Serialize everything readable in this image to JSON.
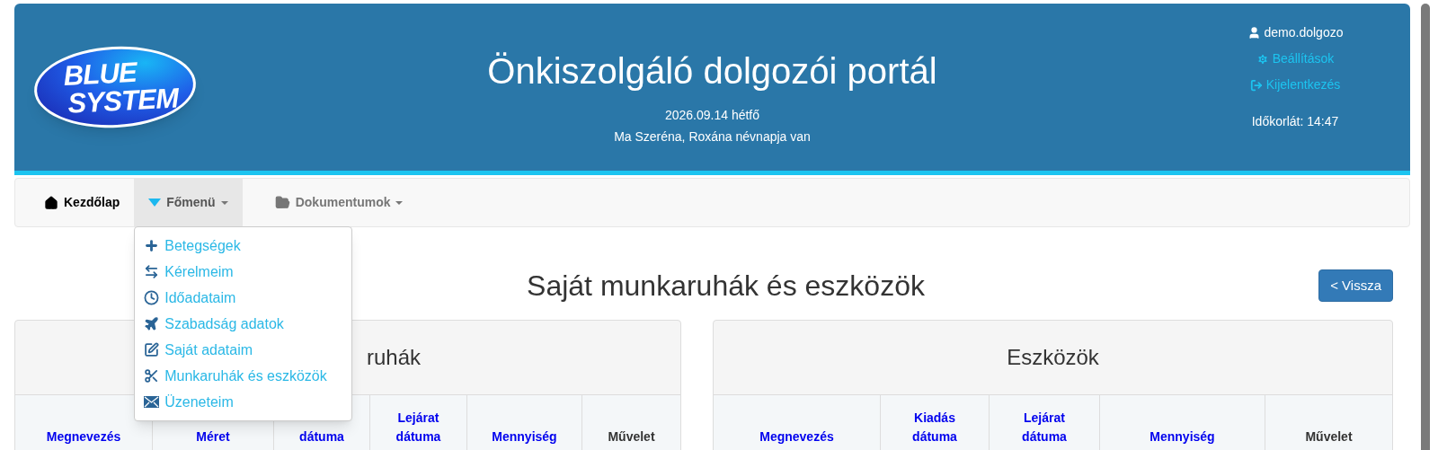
{
  "header": {
    "logo_lines": [
      "BLUE",
      "SYSTEM"
    ],
    "title": "Önkiszolgáló dolgozói portál",
    "date": "2026.09.14 hétfő",
    "nameday": "Ma Szeréna, Roxána névnapja van",
    "user": "demo.dolgozo",
    "links": [
      "Beállítások",
      "Kijelentkezés"
    ],
    "time_limit": "Időkorlát: 14:47"
  },
  "nav": {
    "items": [
      {
        "label": "Kezdőlap",
        "selected": false,
        "caret": false
      },
      {
        "label": "Főmenü",
        "selected": true,
        "caret": true
      },
      {
        "label": "Dokumentumok",
        "selected": false,
        "caret": true
      }
    ]
  },
  "menu": {
    "expanded": true,
    "items": [
      "Betegségek",
      "Kérelmeim",
      "Időadataim",
      "Szabadság adatok",
      "Saját adataim",
      "Munkaruhák és eszközök",
      "Üzeneteim"
    ]
  },
  "page_title": "Saját munkaruhák és eszközök",
  "back_button": "< Vissza",
  "panels": [
    {
      "title": "ruhák",
      "columns": [
        {
          "label": "Megnevezés",
          "sortable": true
        },
        {
          "label": "Méret",
          "sortable": true
        },
        {
          "label": "dátuma",
          "sortable": true
        },
        {
          "label": "Lejárat dátuma",
          "sortable": true
        },
        {
          "label": "Mennyiség",
          "sortable": true
        },
        {
          "label": "Művelet",
          "sortable": false
        }
      ]
    },
    {
      "title": "Eszközök",
      "columns": [
        {
          "label": "Megnevezés",
          "sortable": true
        },
        {
          "label": "Kiadás dátuma",
          "sortable": true
        },
        {
          "label": "Lejárat dátuma",
          "sortable": true
        },
        {
          "label": "Mennyiség",
          "sortable": true
        },
        {
          "label": "Művelet",
          "sortable": false
        }
      ]
    }
  ]
}
